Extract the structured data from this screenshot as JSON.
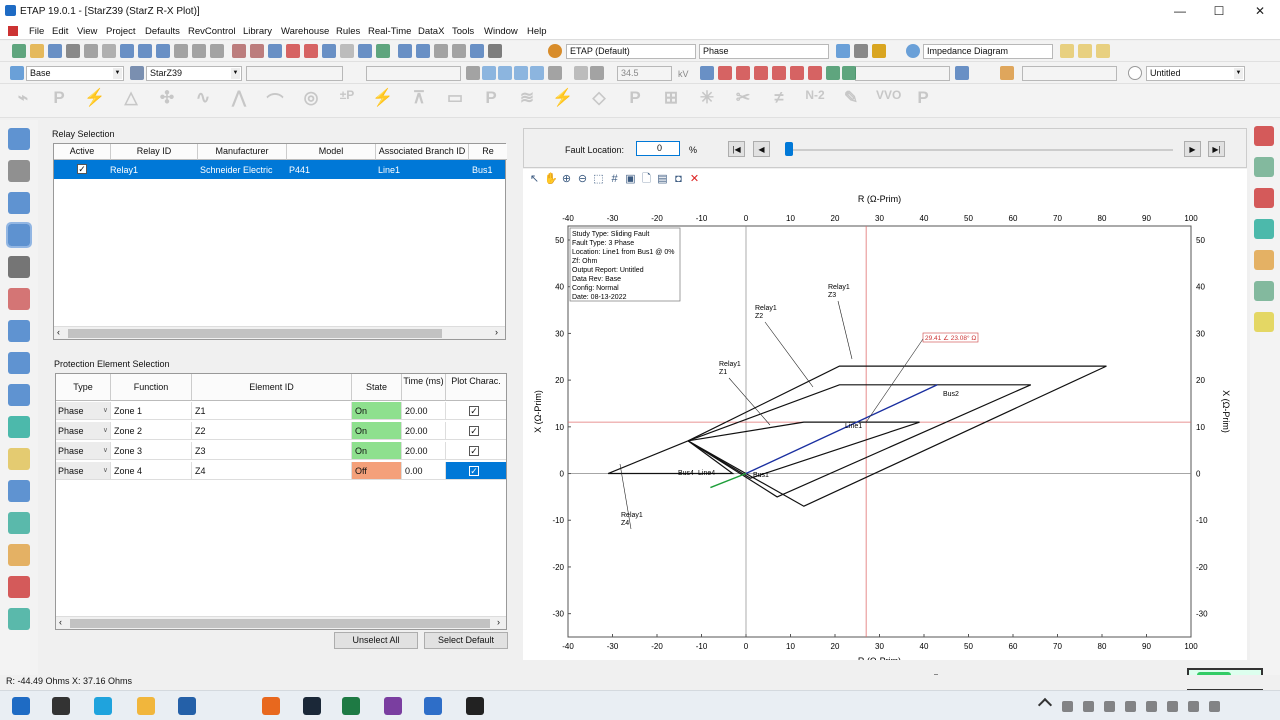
{
  "window": {
    "title": "ETAP 19.0.1  - [StarZ39 (StarZ R-X Plot)]",
    "min": "—",
    "max": "☐",
    "close": "✕"
  },
  "menu": [
    "File",
    "Edit",
    "View",
    "Project",
    "Defaults",
    "RevControl",
    "Library",
    "Warehouse",
    "Rules",
    "Real-Time",
    "DataX",
    "Tools",
    "Window",
    "Help"
  ],
  "toolbar": {
    "etap_default": "ETAP (Default)",
    "phase": "Phase",
    "impedance_diagram": "Impedance Diagram"
  },
  "toolbar2": {
    "base": "Base",
    "starz": "StarZ39",
    "kv_value": "34.5",
    "kv_unit": "kV",
    "untitled": "Untitled"
  },
  "relay_selection": {
    "title": "Relay Selection",
    "columns": [
      "Active",
      "Relay ID",
      "Manufacturer",
      "Model",
      "Associated Branch ID",
      "Re"
    ],
    "rows": [
      {
        "active": "✓",
        "relay_id": "Relay1",
        "manufacturer": "Schneider Electric",
        "model": "P441",
        "branch": "Line1",
        "re": "Bus1"
      }
    ]
  },
  "protection": {
    "title": "Protection Element Selection",
    "columns": [
      "Type",
      "Function",
      "Element ID",
      "State",
      "Time (ms)",
      "Plot Charac."
    ],
    "rows": [
      {
        "type": "Phase",
        "function": "Zone 1",
        "element": "Z1",
        "state": "On",
        "time": "20.00",
        "plot": "✓"
      },
      {
        "type": "Phase",
        "function": "Zone 2",
        "element": "Z2",
        "state": "On",
        "time": "20.00",
        "plot": "✓"
      },
      {
        "type": "Phase",
        "function": "Zone 3",
        "element": "Z3",
        "state": "On",
        "time": "20.00",
        "plot": "✓"
      },
      {
        "type": "Phase",
        "function": "Zone 4",
        "element": "Z4",
        "state": "Off",
        "time": "0.00",
        "plot": "✓"
      }
    ],
    "unselect_all": "Unselect All",
    "select_default": "Select Default"
  },
  "fault": {
    "label": "Fault Location:",
    "value": "0",
    "unit": "%"
  },
  "plot": {
    "xlabel": "R (Ω-Prim)",
    "ylabel": "X (Ω-Prim)",
    "info": [
      "Study Type: Sliding Fault",
      "Fault Type: 3 Phase",
      "Location: Line1 from Bus1 @ 0%",
      "Zf:   Ohm",
      "Output Report: Untitled",
      "Data Rev: Base",
      "Config: Normal",
      "Date: 08-13-2022"
    ],
    "cursor_label": "29.41 ∠ 23.08° Ω",
    "labels": {
      "relay_z2": "Relay1\nZ2",
      "relay_z3": "Relay1\nZ3",
      "relay_z1": "Relay1\nZ1",
      "relay_z4": "Relay1\nZ4",
      "bus2": "Bus2",
      "line1": "Line1",
      "bus4": "Bus4",
      "line4": "Line4",
      "bus1": "Bus1"
    }
  },
  "chart_data": {
    "type": "scatter",
    "title": "",
    "xlabel": "R (Ω-Prim)",
    "ylabel": "X (Ω-Prim)",
    "xlim": [
      -40,
      100
    ],
    "ylim": [
      -35,
      53
    ],
    "xticks": [
      -40,
      -30,
      -20,
      -10,
      0,
      10,
      20,
      30,
      40,
      50,
      60,
      70,
      80,
      90,
      100
    ],
    "yticks": [
      -30,
      -20,
      -10,
      0,
      10,
      20,
      30,
      40,
      50
    ],
    "series": [
      {
        "name": "Z1",
        "points": [
          [
            -13,
            7
          ],
          [
            13,
            11
          ],
          [
            39,
            11
          ],
          [
            1,
            -1
          ],
          [
            -13,
            7
          ]
        ]
      },
      {
        "name": "Z2",
        "points": [
          [
            -13,
            7
          ],
          [
            21,
            19
          ],
          [
            64,
            19
          ],
          [
            7,
            -5
          ],
          [
            -13,
            7
          ]
        ]
      },
      {
        "name": "Z3",
        "points": [
          [
            -13,
            7
          ],
          [
            21,
            23
          ],
          [
            81,
            23
          ],
          [
            13,
            -7
          ],
          [
            -13,
            7
          ]
        ]
      },
      {
        "name": "Z4",
        "points": [
          [
            -31,
            0
          ],
          [
            -13,
            7
          ],
          [
            -3,
            0
          ],
          [
            -31,
            0
          ]
        ]
      },
      {
        "name": "Line1",
        "points": [
          [
            0,
            0
          ],
          [
            43,
            19
          ]
        ]
      },
      {
        "name": "Line4",
        "points": [
          [
            -8,
            -3
          ],
          [
            0,
            0
          ]
        ]
      }
    ],
    "cursor": {
      "x": 27,
      "y": 11
    }
  },
  "status": {
    "text": "R: -44.49 Ohms  X: 37.16 Ohms"
  }
}
